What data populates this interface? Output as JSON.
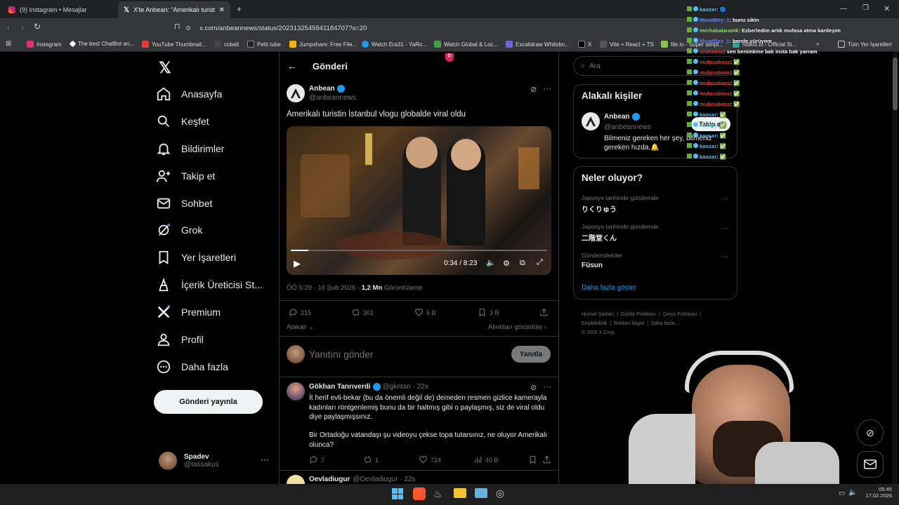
{
  "browser": {
    "tabs": [
      {
        "label": "(9) Instagram • Mesajlar"
      },
      {
        "label": "X'te Anbean: \"Amerikalı turistin İ"
      }
    ],
    "url": "x.com/anbeannews/status/2023132545941184707?s=20",
    "bookmarks": [
      "Instagram",
      "The best ChatBot an...",
      "YouTube Thumbnail...",
      "cobalt",
      "Petit tube",
      "Jumpshare: Free File...",
      "Watch Era31 - YaRo...",
      "Watch Global & Loc...",
      "Excalidraw Whitebo...",
      "X",
      "Vite + React + TS",
      "file.io - Super simpl...",
      "hitbox.io - Official Si..."
    ],
    "all_bookmarks": "Tüm Yer İşaretleri",
    "more": "»"
  },
  "nav": {
    "items": [
      "Anasayfa",
      "Keşfet",
      "Bildirimler",
      "Takip et",
      "Sohbet",
      "Grok",
      "Yer İşaretleri",
      "İçerik Üreticisi St...",
      "Premium",
      "Profil",
      "Daha fazla"
    ],
    "post_button": "Gönderi yayınla",
    "account": {
      "name": "Spadev",
      "handle": "@tassakus"
    }
  },
  "post": {
    "header": "Gönderi",
    "author": {
      "name": "Anbean",
      "handle": "@anbeannews"
    },
    "text": "Amerikalı turistin İstanbul vlogu globalde viral oldu",
    "video": {
      "time": "0:34 / 8:23",
      "progress": 0.068
    },
    "meta": {
      "datetime": "ÖÖ 5:29 · 16 Şub 2026 ·",
      "views": "1,2 Mn",
      "views_label": "Görüntüleme"
    },
    "actions": {
      "replies": "215",
      "reposts": "301",
      "likes": "5 B",
      "bookmarks": "3 B"
    },
    "related": "Alakalı",
    "quotes": "Alıntıları görüntüle",
    "reply_placeholder": "Yanıtını gönder",
    "reply_button": "Yanıtla"
  },
  "replies": [
    {
      "name": "Gökhan Tanrıverdi",
      "handle": "@gkntan · 22s",
      "text1": "İt herif evli-bekar (bu da önemli değil de) demeden resmen gizlice kamerayla kadınları röntgenlemiş bunu da bir haltmış gibi o paylaşmış, siz de viral oldu diye paylaşmışsınız.",
      "text2": "Bir Ortadoğu vatandaşı şu videoyu çekse topa tutarsınız, ne oluyor Amerikalı olunca?",
      "replies": "7",
      "reposts": "1",
      "likes": "724",
      "views": "40 B"
    },
    {
      "name": "Oevladiugur",
      "handle": "@Oevladiugur · 22s"
    }
  ],
  "sidebar": {
    "search_placeholder": "Ara",
    "related_people": {
      "title": "Alakalı kişiler",
      "name": "Anbean",
      "handle": "@anbeannews",
      "bio": "Bilmeniz gereken her şey, bilmeniz gereken hızda.🔔",
      "follow": "Takip et"
    },
    "trends": {
      "title": "Neler oluyor?",
      "items": [
        {
          "context": "Japonya tarihinde gündemde",
          "name": "りくりゅう"
        },
        {
          "context": "Japonya tarihinde gündemde",
          "name": "二階堂くん"
        },
        {
          "context": "Gündemdekiler",
          "name": "Füsun"
        }
      ],
      "more": "Daha fazla göster"
    },
    "footer": [
      "Hizmet Şartları",
      "Gizlilik Politikası",
      "Çerez Politikası",
      "Erişilebilirlik",
      "Reklam bilgisi",
      "Daha fazla ...",
      "© 2026 X Corp."
    ]
  },
  "stream_chat": [
    {
      "user": "kaosxr",
      "msg": ": 🔵",
      "color": "#4fc3f7"
    },
    {
      "user": "MuratBey_1",
      "msg": ": bunu sikin",
      "color": "#5b7cfa"
    },
    {
      "user": "merhabalaramk",
      "msg": ": Ezberledim artık mufasa atma kardeşim",
      "color": "#7ee06b"
    },
    {
      "user": "MuratBey_1",
      "msg": ": bende yürüyom",
      "color": "#5b7cfa"
    },
    {
      "user": "ozanaxsu",
      "msg": ": sen benimkine bak insta bak yarram",
      "color": "#e53935"
    },
    {
      "user": "mufasaboss",
      "msg": ": ✅",
      "color": "#e53935"
    },
    {
      "user": "mufasaboss",
      "msg": ": ✅",
      "color": "#e53935"
    },
    {
      "user": "mufasaboss",
      "msg": ": ✅",
      "color": "#e53935"
    },
    {
      "user": "mufasaboss",
      "msg": ": ✅",
      "color": "#e53935"
    },
    {
      "user": "mufasaboss",
      "msg": ": ✅",
      "color": "#e53935"
    },
    {
      "user": "kaosxr",
      "msg": ": ✅",
      "color": "#4fc3f7"
    },
    {
      "user": "kaosxr",
      "msg": ": ✅",
      "color": "#4fc3f7"
    },
    {
      "user": "kaosxr",
      "msg": ": ✅",
      "color": "#4fc3f7"
    },
    {
      "user": "kaosxr",
      "msg": ": ✅",
      "color": "#4fc3f7"
    },
    {
      "user": "kaosxr",
      "msg": ": ✅",
      "color": "#4fc3f7"
    }
  ],
  "taskbar": {
    "time": "05:45",
    "date": "17.02.2026"
  },
  "colors": {
    "accent": "#1d9bf0",
    "bg": "#000000",
    "border": "#2f3336",
    "muted": "#71767b"
  }
}
